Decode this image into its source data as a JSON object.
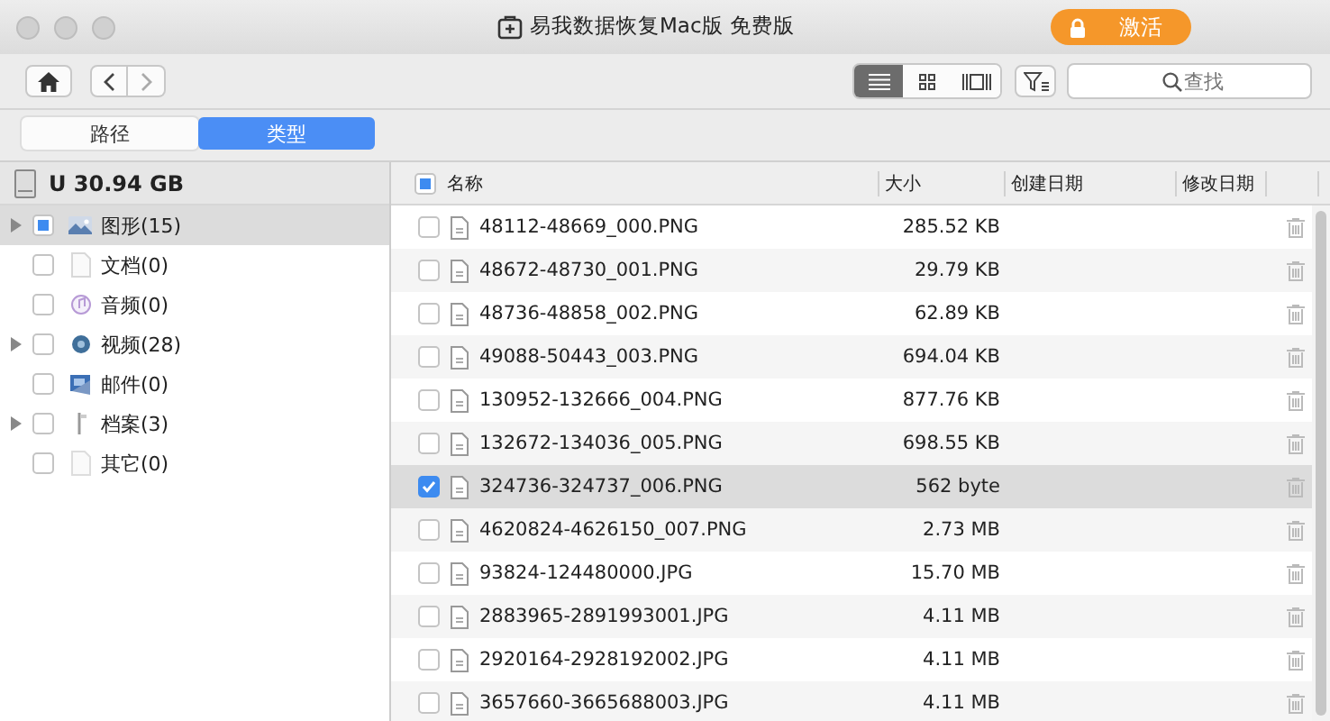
{
  "window": {
    "title": "易我数据恢复Mac版 免费版",
    "activate_button": "激活"
  },
  "toolbar": {
    "view_modes": [
      {
        "kind": "list",
        "selected": true
      },
      {
        "kind": "grid",
        "selected": false
      },
      {
        "kind": "cover",
        "selected": false
      }
    ],
    "search": {
      "placeholder": "查找"
    }
  },
  "tabs": [
    {
      "label": "路径",
      "selected": false
    },
    {
      "label": "类型",
      "selected": true
    }
  ],
  "sidebar": {
    "drive": "U 30.94 GB",
    "items": [
      {
        "label": "图形(15)",
        "kind": "image",
        "expandable": true,
        "checked": false,
        "partial": true,
        "selected": true
      },
      {
        "label": "文档(0)",
        "kind": "document",
        "expandable": false,
        "checked": false,
        "partial": false,
        "selected": false
      },
      {
        "label": "音频(0)",
        "kind": "audio",
        "expandable": false,
        "checked": false,
        "partial": false,
        "selected": false
      },
      {
        "label": "视频(28)",
        "kind": "video",
        "expandable": true,
        "checked": false,
        "partial": false,
        "selected": false
      },
      {
        "label": "邮件(0)",
        "kind": "mail",
        "expandable": false,
        "checked": false,
        "partial": false,
        "selected": false
      },
      {
        "label": "档案(3)",
        "kind": "archive",
        "expandable": true,
        "checked": false,
        "partial": false,
        "selected": false
      },
      {
        "label": "其它(0)",
        "kind": "other",
        "expandable": false,
        "checked": false,
        "partial": false,
        "selected": false
      }
    ]
  },
  "table": {
    "header_partial": true,
    "columns": [
      "名称",
      "大小",
      "创建日期",
      "修改日期"
    ],
    "rows": [
      {
        "name": "48112-48669_000.PNG",
        "size": "285.52 KB",
        "checked": false,
        "selected": false
      },
      {
        "name": "48672-48730_001.PNG",
        "size": "29.79 KB",
        "checked": false,
        "selected": false
      },
      {
        "name": "48736-48858_002.PNG",
        "size": "62.89 KB",
        "checked": false,
        "selected": false
      },
      {
        "name": "49088-50443_003.PNG",
        "size": "694.04 KB",
        "checked": false,
        "selected": false
      },
      {
        "name": "130952-132666_004.PNG",
        "size": "877.76 KB",
        "checked": false,
        "selected": false
      },
      {
        "name": "132672-134036_005.PNG",
        "size": "698.55 KB",
        "checked": false,
        "selected": false
      },
      {
        "name": "324736-324737_006.PNG",
        "size": "562 byte",
        "checked": true,
        "selected": true
      },
      {
        "name": "4620824-4626150_007.PNG",
        "size": "2.73 MB",
        "checked": false,
        "selected": false
      },
      {
        "name": "93824-124480000.JPG",
        "size": "15.70 MB",
        "checked": false,
        "selected": false
      },
      {
        "name": "2883965-2891993001.JPG",
        "size": "4.11 MB",
        "checked": false,
        "selected": false
      },
      {
        "name": "2920164-2928192002.JPG",
        "size": "4.11 MB",
        "checked": false,
        "selected": false
      },
      {
        "name": "3657660-3665688003.JPG",
        "size": "4.11 MB",
        "checked": false,
        "selected": false
      }
    ]
  }
}
